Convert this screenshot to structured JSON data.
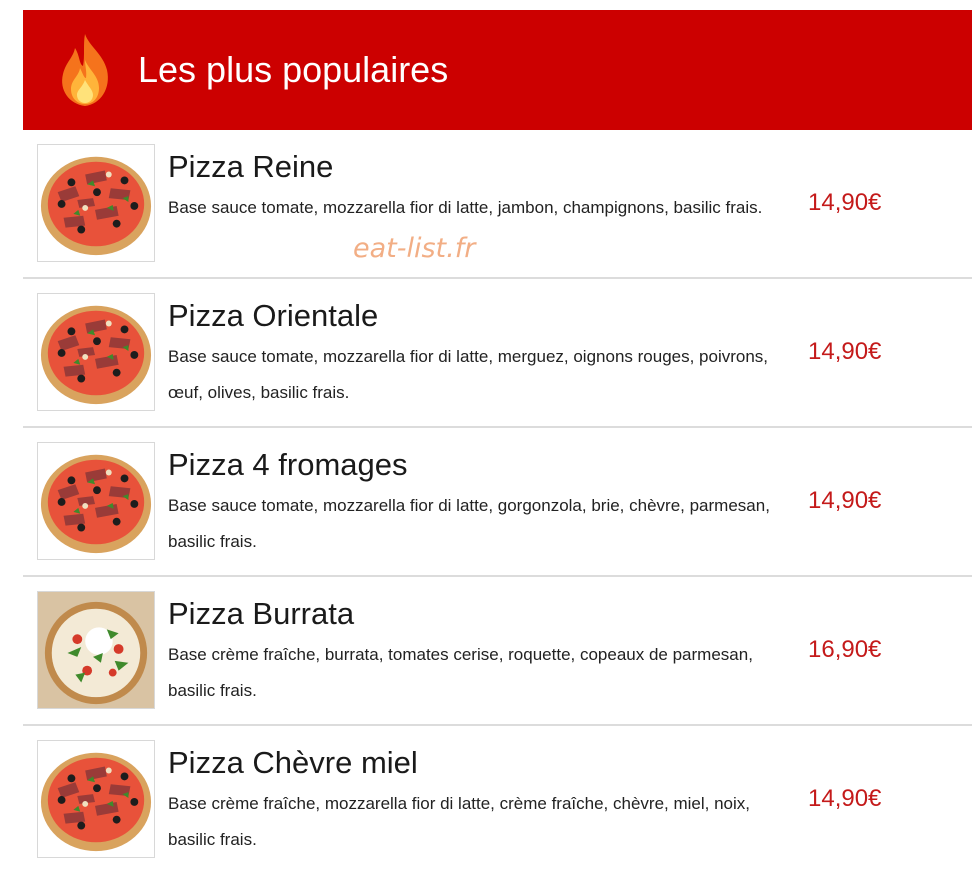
{
  "header": {
    "icon": "fire-icon",
    "title": "Les plus populaires",
    "background_color": "#cc0000"
  },
  "watermark": "eat-list.fr",
  "price_color": "#c41a1a",
  "items": [
    {
      "name": "Pizza Reine",
      "description": "Base sauce tomate, mozzarella fior di latte, jambon, champignons, basilic frais.",
      "price": "14,90€",
      "image": "pizza-photo-icon"
    },
    {
      "name": "Pizza Orientale",
      "description": "Base sauce tomate, mozzarella fior di latte, merguez, oignons rouges, poivrons, œuf, olives, basilic frais.",
      "price": "14,90€",
      "image": "pizza-photo-icon"
    },
    {
      "name": "Pizza 4 fromages",
      "description": "Base sauce tomate, mozzarella fior di latte, gorgonzola, brie, chèvre, parmesan, basilic frais.",
      "price": "14,90€",
      "image": "pizza-photo-icon"
    },
    {
      "name": "Pizza Burrata",
      "description": "Base crème fraîche, burrata, tomates cerise, roquette, copeaux de parmesan, basilic frais.",
      "price": "16,90€",
      "image": "burrata-pizza-photo-icon"
    },
    {
      "name": "Pizza Chèvre miel",
      "description": "Base crème fraîche, mozzarella fior di latte, crème fraîche, chèvre, miel, noix, basilic frais.",
      "price": "14,90€",
      "image": "pizza-photo-icon"
    }
  ]
}
